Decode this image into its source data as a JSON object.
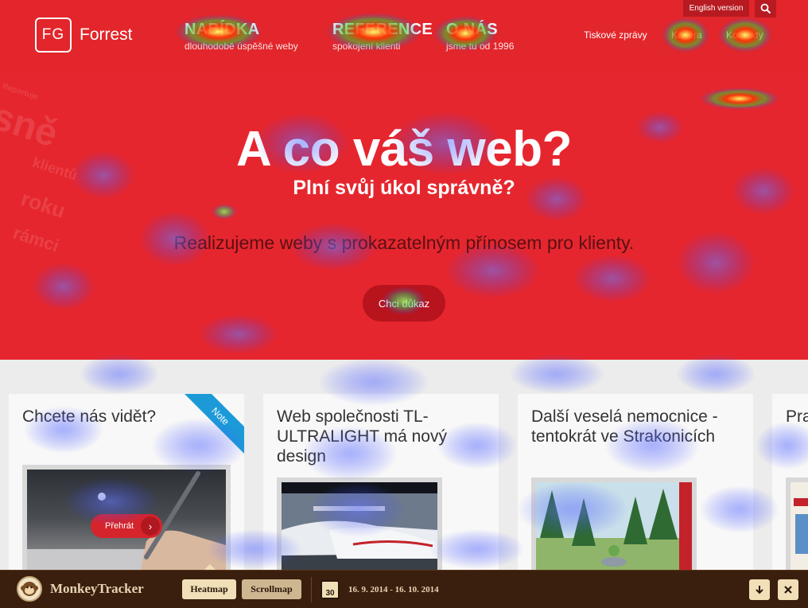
{
  "site": {
    "logo_text": "FG",
    "brand": "Forrest",
    "nav": [
      {
        "title": "NABÍDKA",
        "subtitle": "dlouhodobě úspěšné weby"
      },
      {
        "title": "REFERENCE",
        "subtitle": "spokojení klienti"
      },
      {
        "title": "O NÁS",
        "subtitle": "jsme tu od 1996"
      }
    ],
    "english_label": "English version",
    "right_links": [
      "Tiskové zprávy",
      "Kariéra",
      "Kontakty"
    ]
  },
  "hero": {
    "title": "A co váš web?",
    "subtitle": "Plní svůj úkol správně?",
    "tagline": "Realizujeme weby s prokazatelným přínosem pro klienty.",
    "cta": "Chci důkaz",
    "bg_words": [
      "sně",
      "klientů",
      "roku",
      "rámci",
      "Reportuje"
    ]
  },
  "cards": [
    {
      "title": "Chcete nás vidět?",
      "ribbon": "Note",
      "play_label": "Přehrát"
    },
    {
      "title": "Web společnosti TL-ULTRALIGHT má nový design"
    },
    {
      "title": "Další veselá nemocnice - tentokrát ve Strakonicích"
    },
    {
      "title": "Pra... má..."
    }
  ],
  "tracker": {
    "name": "MonkeyTracker",
    "tabs": [
      "Heatmap",
      "Scrollmap"
    ],
    "active_tab": "Heatmap",
    "calendar_day": "30",
    "date_range": "16. 9. 2014 - 16. 10. 2014",
    "down_icon": "arrow-down-icon",
    "close_icon": "close-icon"
  },
  "colors": {
    "brand_red": "#e2262b",
    "dark_red": "#b8141e",
    "tracker_brown": "#3a1f0e",
    "tracker_cream": "#f1dfb8",
    "ribbon_blue": "#1c9ad8"
  }
}
